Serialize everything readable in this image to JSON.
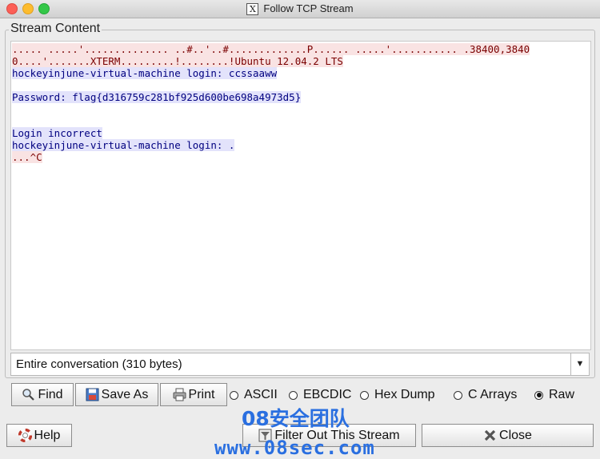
{
  "window": {
    "title": "Follow TCP Stream",
    "title_icon_glyph": "X"
  },
  "group": {
    "label": "Stream Content"
  },
  "stream": {
    "lines": [
      {
        "text": "..... .....'.............. ..#..'..#.............P...... .....'........... .38400,3840",
        "dir": "client"
      },
      {
        "text": "0....'.......XTERM.........!........!Ubuntu 12.04.2 LTS",
        "dir": "client"
      },
      {
        "text": "hockeyinjune-virtual-machine login: ccssaaww",
        "dir": "server"
      },
      {
        "text": "",
        "dir": "none"
      },
      {
        "text": "Password: flag{d316759c281bf925d600be698a4973d5}",
        "dir": "server"
      },
      {
        "text": "",
        "dir": "none"
      },
      {
        "text": "",
        "dir": "none"
      },
      {
        "text": "Login incorrect",
        "dir": "server"
      },
      {
        "text": "hockeyinjune-virtual-machine login: .",
        "dir": "server"
      },
      {
        "text": "...^C",
        "dir": "client"
      }
    ]
  },
  "conversation_select": {
    "value": "Entire conversation (310 bytes)"
  },
  "buttons": {
    "find": "Find",
    "save_as": "Save As",
    "print": "Print",
    "help": "Help",
    "filter_out": "Filter Out This Stream",
    "close": "Close"
  },
  "format_options": [
    {
      "label": "ASCII",
      "selected": false
    },
    {
      "label": "EBCDIC",
      "selected": false
    },
    {
      "label": "Hex Dump",
      "selected": false
    },
    {
      "label": "C Arrays",
      "selected": false
    },
    {
      "label": "Raw",
      "selected": true
    }
  ],
  "watermark": {
    "line1": "08安全团队",
    "line2": "www.08sec.com"
  },
  "colors": {
    "client_text": "#7a0000",
    "client_bg": "#f9e3e3",
    "server_text": "#000080",
    "server_bg": "#e3e3fb",
    "watermark": "#2a6fe0"
  }
}
